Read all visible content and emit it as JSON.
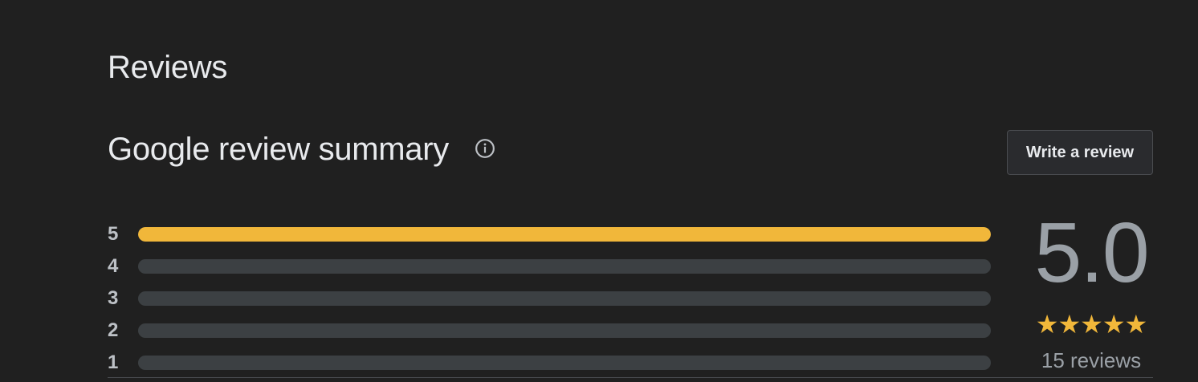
{
  "reviews": {
    "heading": "Reviews",
    "summary_title": "Google review summary",
    "info_icon": "info-icon",
    "write_review_label": "Write a review",
    "rating_distribution": [
      {
        "stars": "5",
        "fraction": 1.0
      },
      {
        "stars": "4",
        "fraction": 0.0
      },
      {
        "stars": "3",
        "fraction": 0.0
      },
      {
        "stars": "2",
        "fraction": 0.0
      },
      {
        "stars": "1",
        "fraction": 0.0
      }
    ],
    "average_rating": "5.0",
    "stars_display": "★★★★★",
    "stars_value": 5,
    "review_count": "15 reviews"
  },
  "colors": {
    "background": "#202020",
    "accent_star": "#f1b73a",
    "bar_track": "#3c4043",
    "text_primary": "#e8eaed",
    "text_secondary": "#9aa0a6"
  }
}
